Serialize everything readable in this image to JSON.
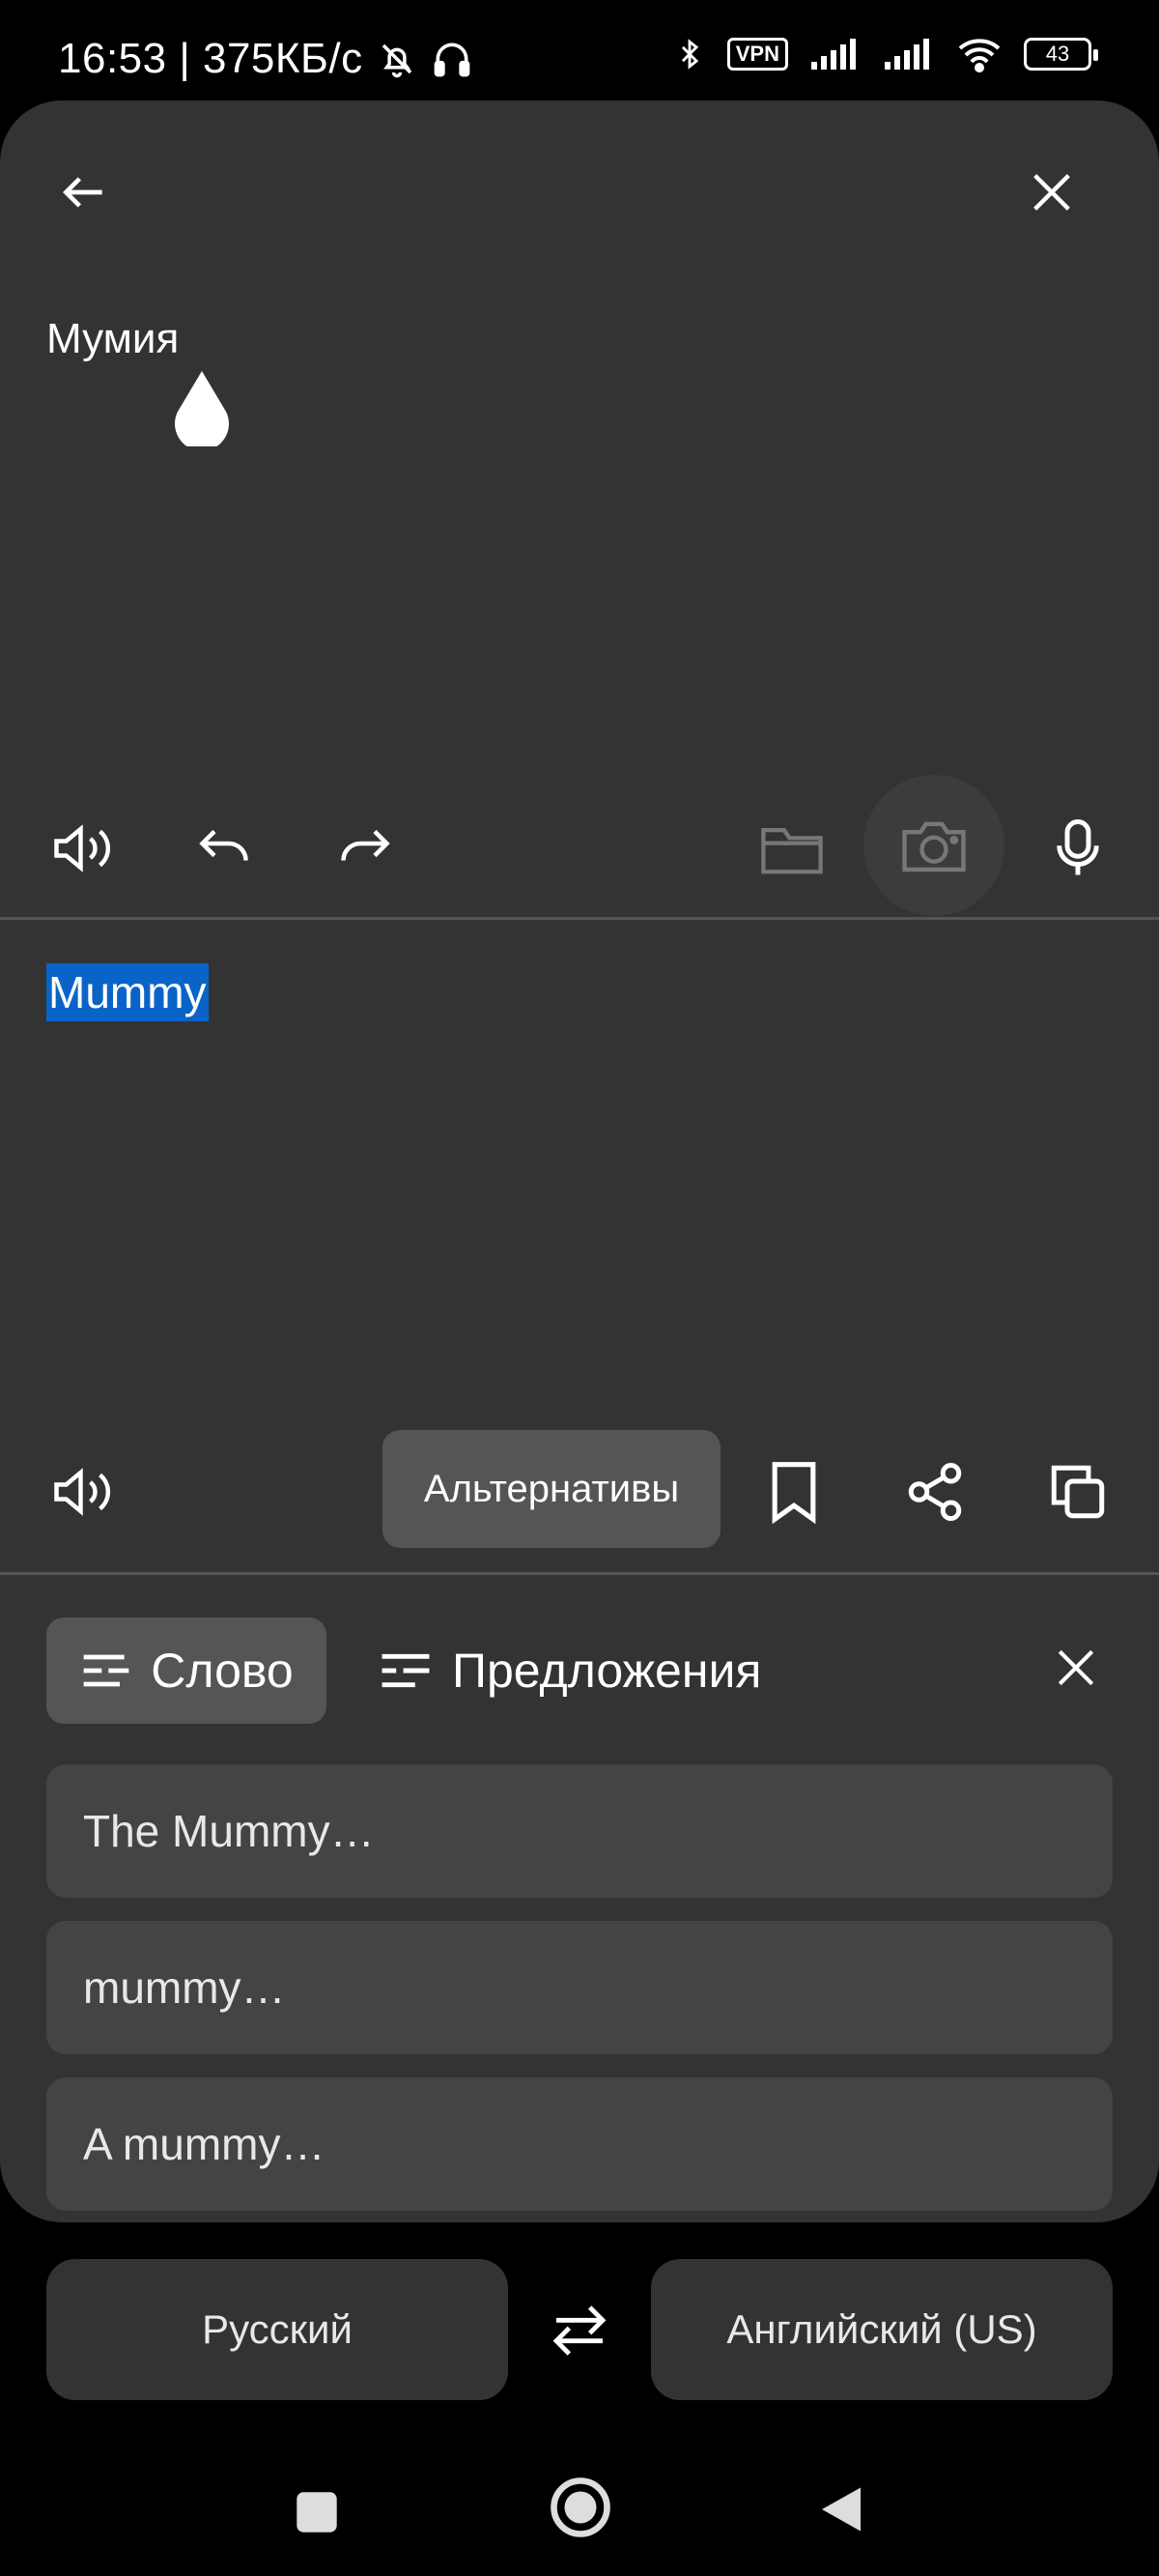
{
  "status": {
    "time_speed": "16:53 | 375КБ/с",
    "vpn": "VPN",
    "battery": "43"
  },
  "source": {
    "text": "Мумия"
  },
  "target": {
    "text": "Mummy"
  },
  "actions": {
    "alternatives": "Альтернативы"
  },
  "tabs": [
    {
      "label": "Слово",
      "active": true
    },
    {
      "label": "Предложения",
      "active": false
    }
  ],
  "suggestions": [
    "The Mummy…",
    "mummy…",
    "A mummy…"
  ],
  "languages": {
    "source": "Русский",
    "target": "Английский (US)"
  },
  "icons": {
    "back": "arrow-left-icon",
    "close": "close-icon",
    "speaker": "speaker-icon",
    "undo": "undo-icon",
    "redo": "redo-icon",
    "folder": "folder-icon",
    "camera": "camera-icon",
    "mic": "microphone-icon",
    "bookmark": "bookmark-icon",
    "share": "share-icon",
    "copy": "copy-icon",
    "swap": "swap-icon"
  },
  "colors": {
    "card": "#333333",
    "selection": "#0a64c8",
    "chip": "#555555",
    "suggestion_bg": "#444444"
  }
}
